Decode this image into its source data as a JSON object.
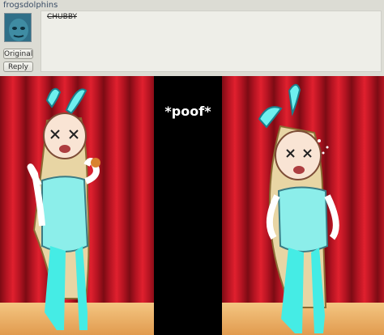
{
  "post": {
    "username": "frogsdolphins",
    "comment_text": "CHUBBY",
    "original_label": "Original",
    "reply_label": "Reply"
  },
  "comic": {
    "poof_text": "*poof*"
  }
}
